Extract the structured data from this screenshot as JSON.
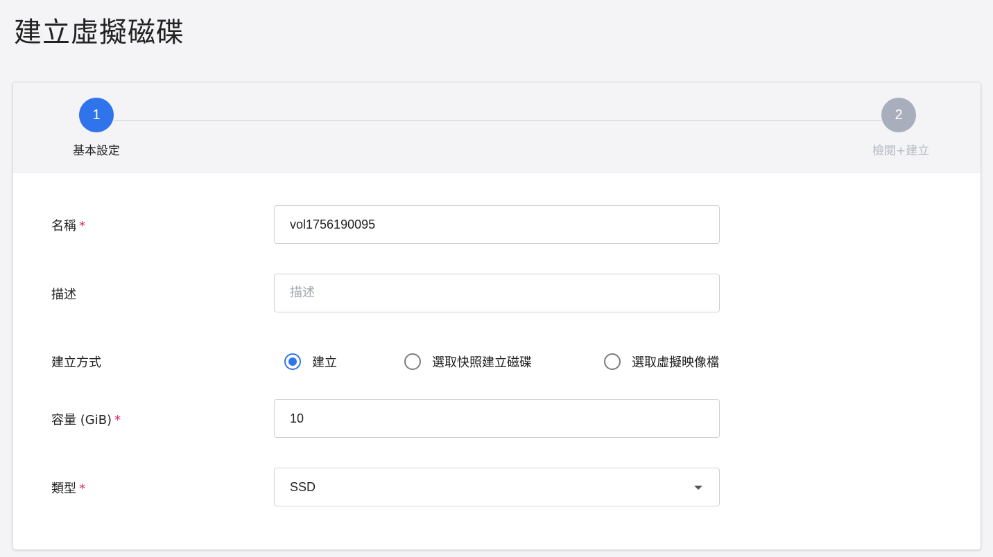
{
  "page": {
    "title": "建立虛擬磁碟"
  },
  "stepper": {
    "steps": [
      {
        "number": "1",
        "label": "基本設定",
        "state": "active"
      },
      {
        "number": "2",
        "label": "檢閱+建立",
        "state": "inactive"
      }
    ],
    "colors": {
      "active": "#2f74eb",
      "inactive": "#a9aebd"
    }
  },
  "form": {
    "required_mark": "*",
    "name": {
      "label": "名稱",
      "value": "vol1756190095"
    },
    "description": {
      "label": "描述",
      "placeholder": "描述"
    },
    "creation_method": {
      "label": "建立方式",
      "options": [
        {
          "label": "建立",
          "checked": true
        },
        {
          "label": "選取快照建立磁碟",
          "checked": false
        },
        {
          "label": "選取虛擬映像檔",
          "checked": false
        }
      ]
    },
    "capacity": {
      "label": "容量 (GiB)",
      "value": "10"
    },
    "type": {
      "label": "類型",
      "value": "SSD"
    }
  },
  "colors": {
    "accent": "#2f74eb",
    "required": "#e0245e"
  }
}
